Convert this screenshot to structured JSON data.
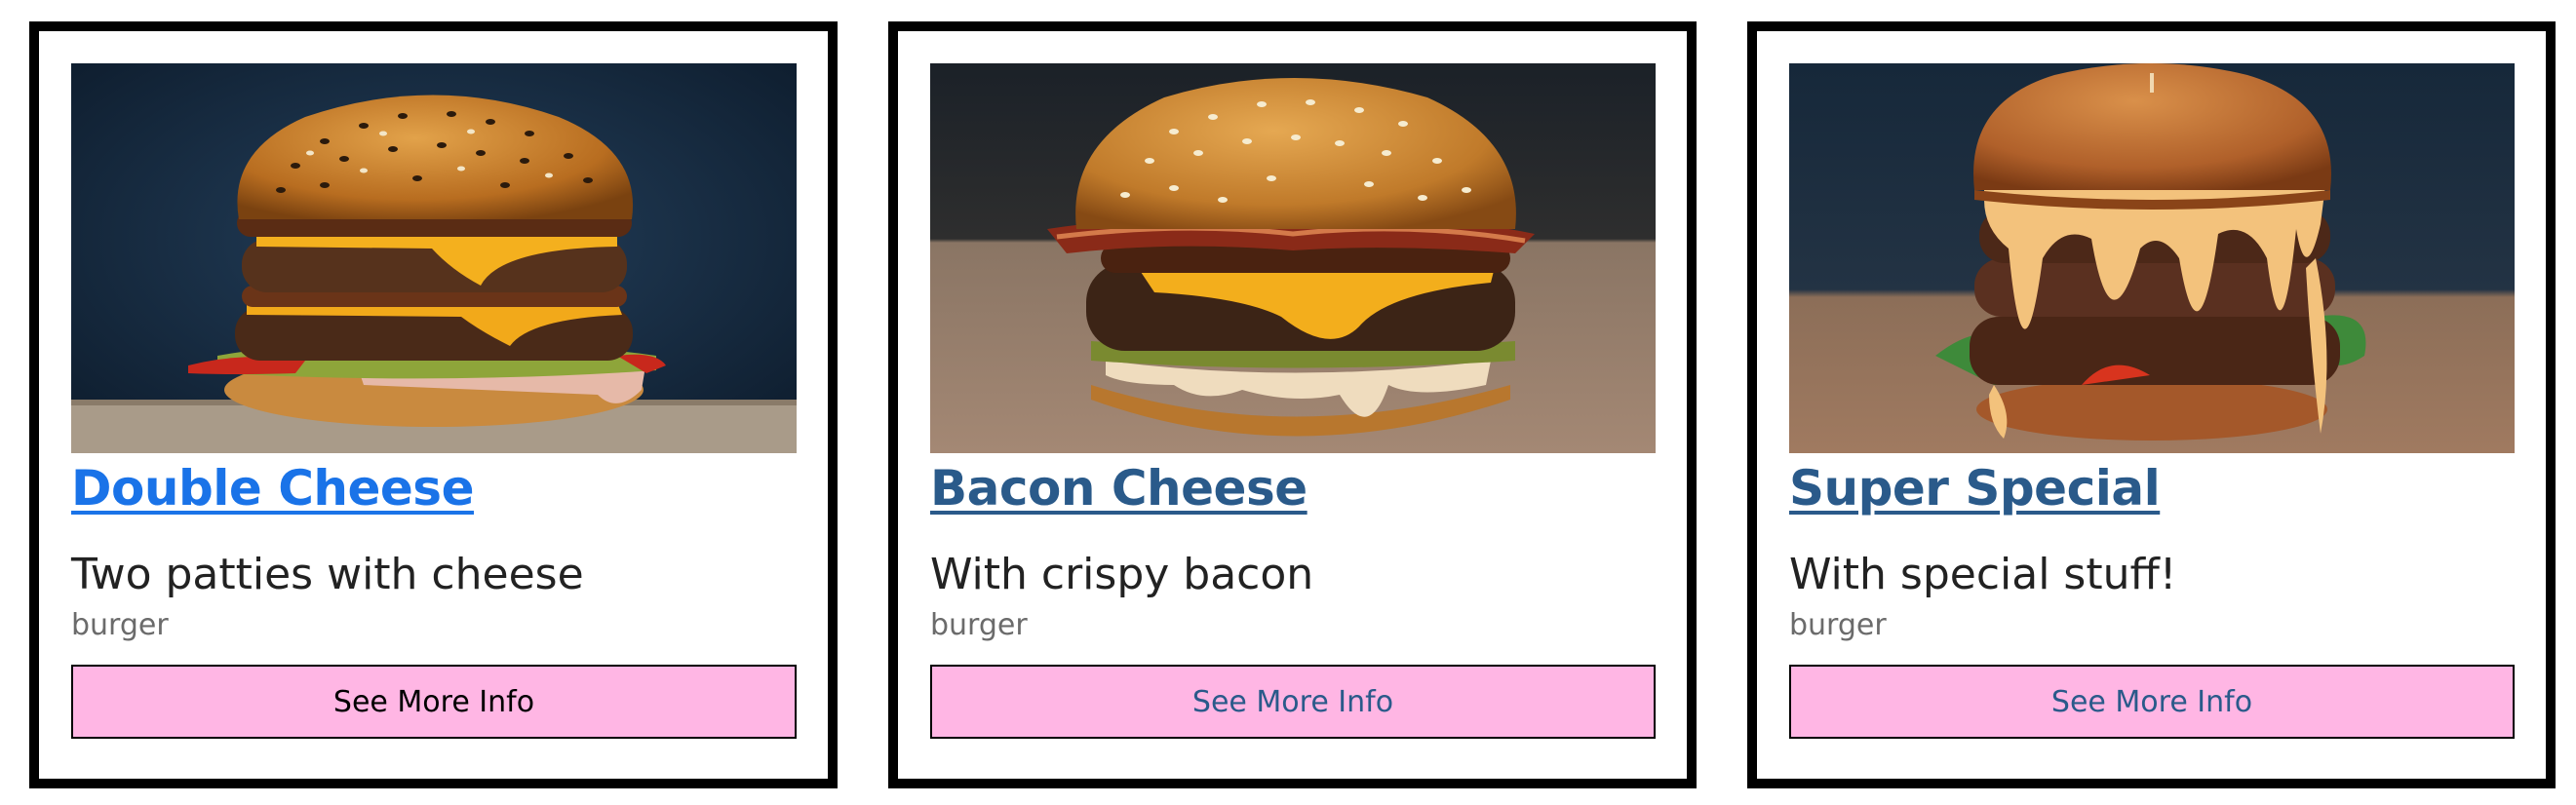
{
  "colors": {
    "card_border": "#000000",
    "button_bg": "#ffb6e4",
    "title_link_active": "#1a73e8",
    "title_link_visited": "#2a5a8a",
    "button_text_default": "#000000",
    "button_text_link": "#2a5a8a",
    "category_text": "#6b6b6b"
  },
  "cards": [
    {
      "title": "Double Cheese",
      "description": "Two patties with cheese",
      "category": "burger",
      "button_label": "See More Info",
      "image_icon": "double-cheeseburger-photo",
      "title_color": "#1a73e8",
      "button_text_color": "#000000"
    },
    {
      "title": "Bacon Cheese",
      "description": "With crispy bacon",
      "category": "burger",
      "button_label": "See More Info",
      "image_icon": "bacon-cheeseburger-photo",
      "title_color": "#2a5a8a",
      "button_text_color": "#2a5a8a"
    },
    {
      "title": "Super Special",
      "description": "With special stuff!",
      "category": "burger",
      "button_label": "See More Info",
      "image_icon": "special-burger-photo",
      "title_color": "#2a5a8a",
      "button_text_color": "#2a5a8a"
    }
  ]
}
